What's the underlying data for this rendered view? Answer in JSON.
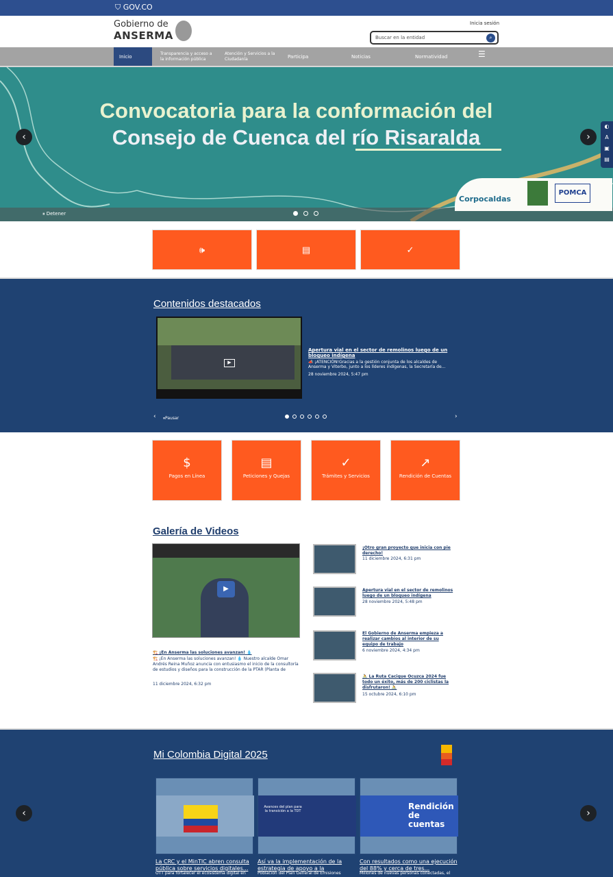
{
  "govbar": {
    "label": "GOV.CO"
  },
  "header": {
    "logo_line1": "Gobierno de",
    "logo_line2": "ANSERMA",
    "login": "Inicia sesión",
    "search_placeholder": "Buscar en la entidad"
  },
  "nav": {
    "items": [
      "Inicio",
      "Transparencia y acceso a la información pública",
      "Atención y Servicios a la Ciudadanía",
      "Participa",
      "Noticias",
      "Normatividad"
    ]
  },
  "hero": {
    "line1": "Convocatoria para la conformación del",
    "line2": "Consejo de Cuenca del río Risaralda",
    "stop": "Detener",
    "partner1": "Corpocaldas",
    "partner2": "POMCA"
  },
  "featured": {
    "title": "Contenidos destacados",
    "item_title": "Apertura vial en el sector de remolinos luego de un bloqueo indígena",
    "item_desc": "📣 ¡ATENCIÓN!Gracias a la gestión conjunta de los alcaldes de Anserma y Viterbo, junto a los líderes indígenas, la Secretaría de...",
    "item_date": "28 noviembre 2024, 5:47 pm",
    "pause": "Pausar"
  },
  "cards": [
    {
      "label": "Pagos en Línea",
      "icon": "$"
    },
    {
      "label": "Peticiones y Quejas",
      "icon": "▤"
    },
    {
      "label": "Trámites y Servicios",
      "icon": "✓"
    },
    {
      "label": "Rendición de Cuentas",
      "icon": "↗"
    }
  ],
  "gallery": {
    "title": "Galería de Videos",
    "main_title": "🏗️ ¡En Anserma las soluciones avanzan! 💧",
    "main_desc": "🏗️ ¡En Anserma las soluciones avanzan! 💧 Nuestro alcalde Omar Andrés Reina Muñoz anuncia con entusiasmo el inicio de la consultoría de estudios y diseños para la construcción de la PTAR (Planta de",
    "main_date": "11 diciembre 2024, 6:32 pm",
    "items": [
      {
        "title": "¡Otro gran proyecto que inicia con pie derecho!",
        "date": "11 diciembre 2024, 6:31 pm"
      },
      {
        "title": "Apertura vial en el sector de remolinos luego de un bloqueo indígena",
        "date": "28 noviembre 2024, 5:48 pm"
      },
      {
        "title": "El Gobierno de Anserma empieza a realizar cambios al interior de su equipo de trabajo",
        "date": "6 noviembre 2024, 4:34 pm"
      },
      {
        "title": "🚴 La Ruta Cacique Ocuzca 2024 fue todo un éxito, más de 200 ciclistas la disfrutaron! 🚴",
        "date": "15 octubre 2024, 6:10 pm"
      }
    ]
  },
  "digital": {
    "title": "Mi Colombia Digital 2025",
    "items": [
      {
        "title": "La CRC y el MinTIC abren consulta pública sobre servicios digitales...",
        "desc": "OTT para fortalecer el ecosistema digital en"
      },
      {
        "title": "Así va la implementación de la estrategia de apoyo a la",
        "desc": "Población del Plan General de Emisiones"
      },
      {
        "title": "Con resultados como una ejecución del 88% y cerca de tres...",
        "desc": "Millones de nuevas personas conectadas, el"
      }
    ],
    "card2_text": "Avances del plan para la transición a la TDT",
    "card3_text": "Rendición de cuentas"
  }
}
